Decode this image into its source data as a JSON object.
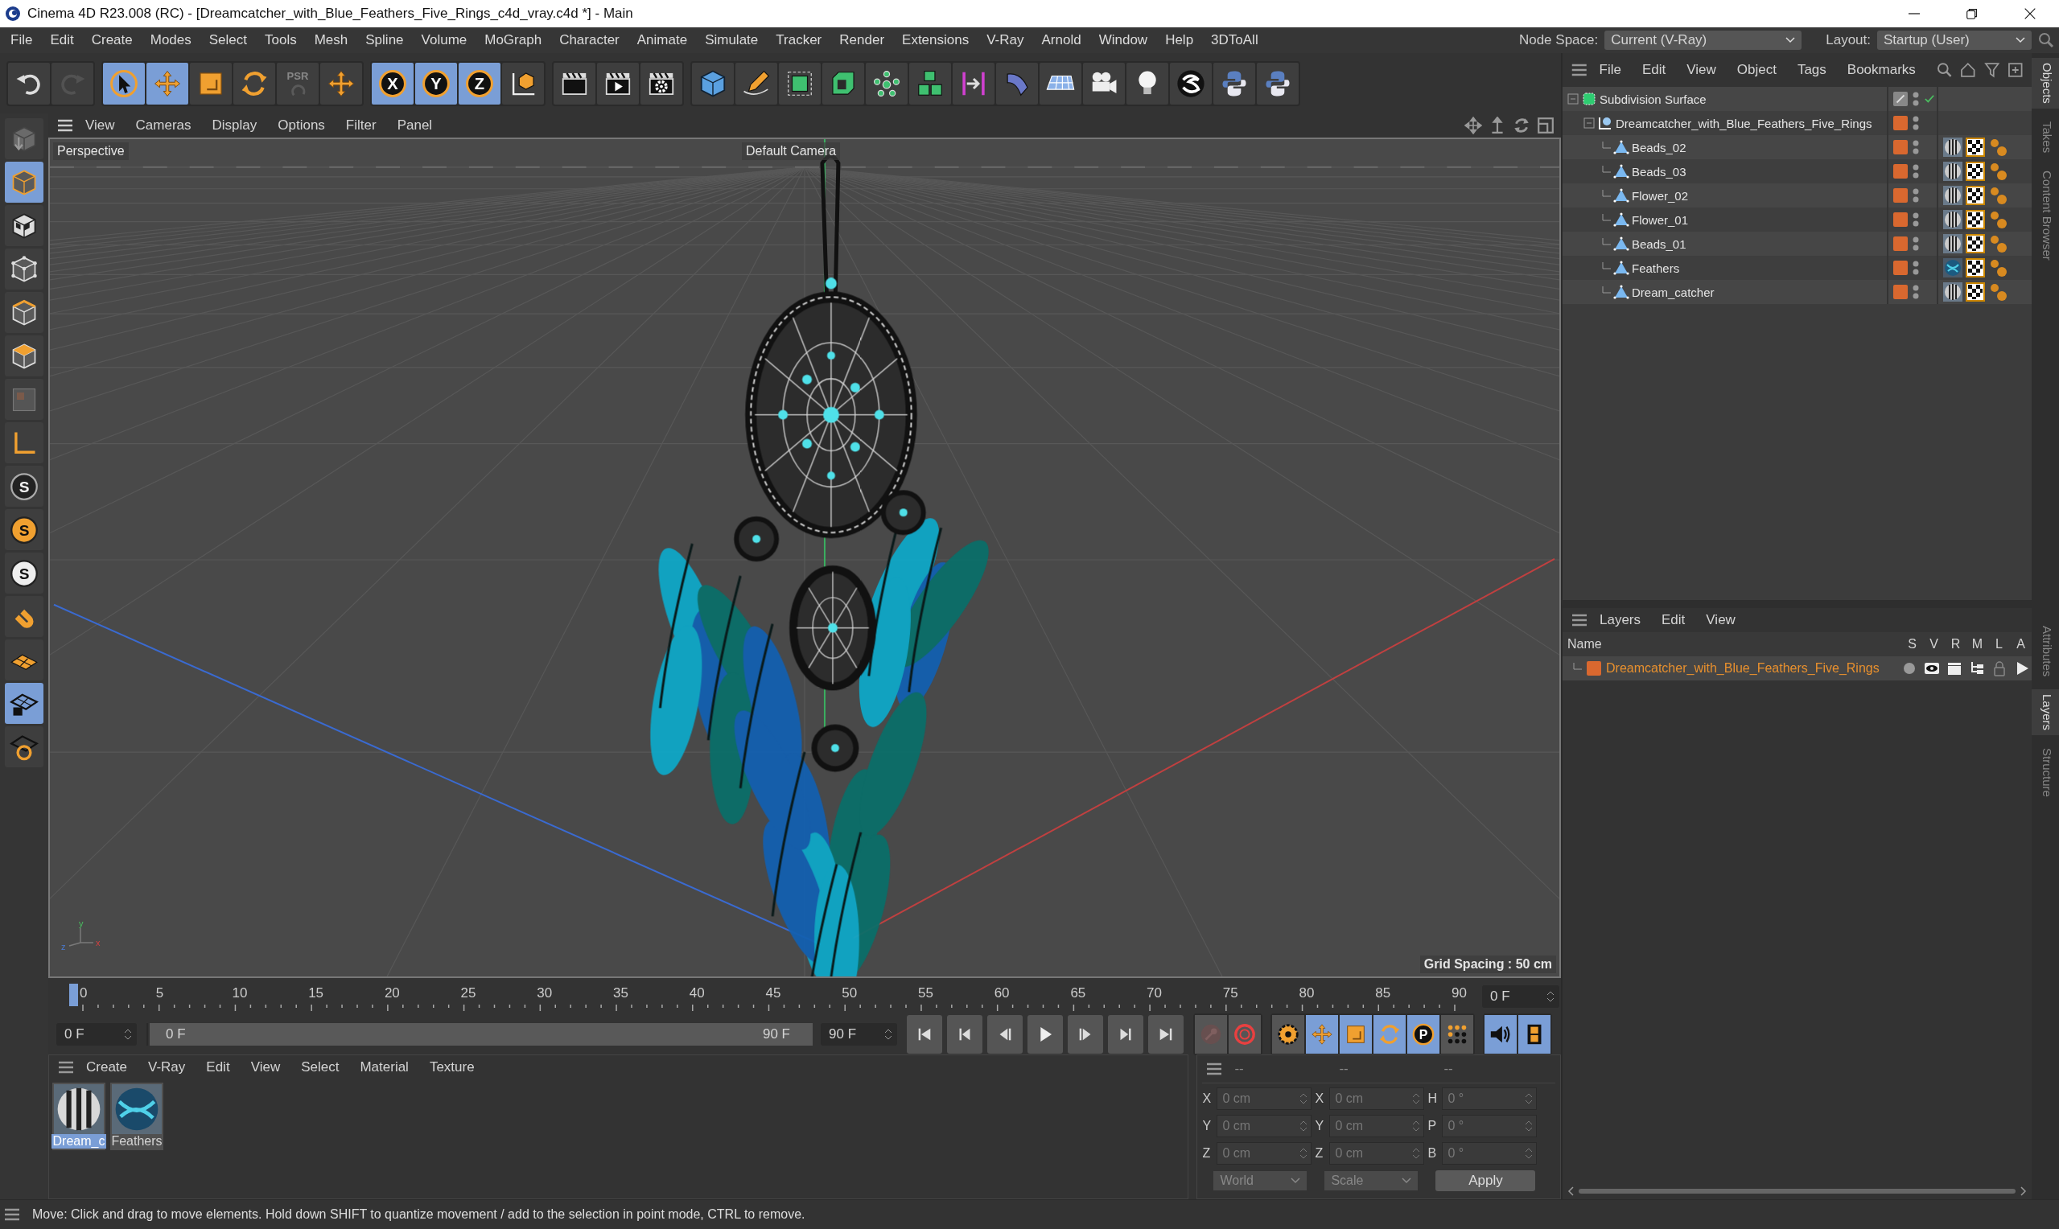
{
  "window": {
    "title": "Cinema 4D R23.008 (RC) - [Dreamcatcher_with_Blue_Feathers_Five_Rings_c4d_vray.c4d *] - Main"
  },
  "menu": [
    "File",
    "Edit",
    "Create",
    "Modes",
    "Select",
    "Tools",
    "Mesh",
    "Spline",
    "Volume",
    "MoGraph",
    "Character",
    "Animate",
    "Simulate",
    "Tracker",
    "Render",
    "Extensions",
    "V-Ray",
    "Arnold",
    "Window",
    "Help",
    "3DToAll"
  ],
  "node_space": {
    "label": "Node Space:",
    "value": "Current (V-Ray)"
  },
  "layout": {
    "label": "Layout:",
    "value": "Startup (User)"
  },
  "toolbar": [
    [
      {
        "kind": "undo",
        "selected": false,
        "disabled": false
      },
      {
        "kind": "redo",
        "selected": false,
        "disabled": true
      }
    ],
    [
      {
        "kind": "select",
        "selected": true,
        "disabled": false
      },
      {
        "kind": "move",
        "selected": true,
        "disabled": false
      },
      {
        "kind": "scale",
        "selected": false,
        "disabled": false
      },
      {
        "kind": "rotate",
        "selected": false,
        "disabled": false
      },
      {
        "kind": "psr",
        "label": "PSR",
        "selected": false,
        "disabled": true
      },
      {
        "kind": "add",
        "selected": false,
        "disabled": false
      }
    ],
    [
      {
        "kind": "axis",
        "label": "X",
        "selected": true,
        "disabled": false
      },
      {
        "kind": "axis",
        "label": "Y",
        "selected": true,
        "disabled": false
      },
      {
        "kind": "axis",
        "label": "Z",
        "selected": true,
        "disabled": false
      },
      {
        "kind": "coord",
        "selected": false,
        "disabled": false
      }
    ],
    [
      {
        "kind": "clapper",
        "selected": false,
        "disabled": false
      },
      {
        "kind": "render",
        "selected": false,
        "disabled": false
      },
      {
        "kind": "render-settings",
        "selected": false,
        "disabled": false
      }
    ],
    [
      {
        "kind": "cube",
        "selected": false,
        "disabled": false
      },
      {
        "kind": "pen",
        "selected": false,
        "disabled": false
      },
      {
        "kind": "subdiv",
        "selected": false,
        "disabled": false
      },
      {
        "kind": "extrude",
        "selected": false,
        "disabled": false
      },
      {
        "kind": "cloner",
        "selected": false,
        "disabled": false
      },
      {
        "kind": "array",
        "selected": false,
        "disabled": false
      },
      {
        "kind": "deformer",
        "selected": false,
        "disabled": false
      },
      {
        "kind": "bend",
        "selected": false,
        "disabled": false
      },
      {
        "kind": "floor",
        "selected": false,
        "disabled": false
      },
      {
        "kind": "camera",
        "selected": false,
        "disabled": false
      },
      {
        "kind": "light",
        "selected": false,
        "disabled": false
      },
      {
        "kind": "vray",
        "selected": false,
        "disabled": false
      },
      {
        "kind": "python",
        "selected": false,
        "disabled": false
      },
      {
        "kind": "python",
        "selected": false,
        "disabled": false
      }
    ]
  ],
  "left_tools": [
    {
      "kind": "editable",
      "selected": false
    },
    {
      "kind": "model",
      "selected": true
    },
    {
      "kind": "texture",
      "selected": false
    },
    {
      "kind": "points",
      "selected": false
    },
    {
      "kind": "edges",
      "selected": false
    },
    {
      "kind": "polygons",
      "selected": false
    },
    {
      "kind": "uv",
      "selected": false
    },
    {
      "kind": "axis-mode",
      "selected": false
    },
    {
      "kind": "snap-dark",
      "label": "S",
      "selected": false
    },
    {
      "kind": "snap",
      "label": "S",
      "selected": false
    },
    {
      "kind": "snap-light",
      "label": "S",
      "selected": false
    },
    {
      "kind": "magnet",
      "selected": false
    },
    {
      "kind": "workplane",
      "selected": false
    },
    {
      "kind": "workplane-lock",
      "selected": true
    },
    {
      "kind": "planar",
      "selected": false
    }
  ],
  "viewport": {
    "menu": [
      "View",
      "Cameras",
      "Display",
      "Options",
      "Filter",
      "Panel"
    ],
    "view_name": "Perspective",
    "camera": "Default Camera",
    "grid_spacing": "Grid Spacing : 50 cm",
    "gizmo": {
      "x": "x",
      "y": "y",
      "z": "z"
    }
  },
  "timeline": {
    "ticks": [
      "0",
      "5",
      "10",
      "15",
      "20",
      "25",
      "30",
      "35",
      "40",
      "45",
      "50",
      "55",
      "60",
      "65",
      "70",
      "75",
      "80",
      "85",
      "90"
    ],
    "frame": "0 F",
    "start": "0 F",
    "range_start": "0 F",
    "range_end": "90 F",
    "range": {
      "level": 1
    },
    "end": "90 F"
  },
  "playback": [
    {
      "kind": "first"
    },
    {
      "kind": "prev-key"
    },
    {
      "kind": "prev-frame"
    },
    {
      "kind": "play"
    },
    {
      "kind": "next-frame"
    },
    {
      "kind": "next-key"
    },
    {
      "kind": "last"
    }
  ],
  "anim_tools": [
    [
      {
        "kind": "record",
        "selected": false,
        "disabled": true
      },
      {
        "kind": "autokey",
        "selected": false,
        "disabled": false
      }
    ],
    [
      {
        "kind": "key-settings",
        "selected": false,
        "disabled": false
      },
      {
        "kind": "move",
        "selected": true,
        "disabled": false
      },
      {
        "kind": "scale",
        "selected": true,
        "disabled": false
      },
      {
        "kind": "rotate",
        "selected": true,
        "disabled": false
      },
      {
        "kind": "param",
        "label": "P",
        "selected": true,
        "disabled": false
      },
      {
        "kind": "dots",
        "selected": false,
        "disabled": false
      }
    ],
    [
      {
        "kind": "sound",
        "selected": true,
        "disabled": false
      },
      {
        "kind": "film",
        "selected": true,
        "disabled": false
      }
    ]
  ],
  "materials": {
    "menu": [
      "Create",
      "V-Ray",
      "Edit",
      "View",
      "Select",
      "Material",
      "Texture"
    ],
    "items": [
      {
        "name": "Dream_c",
        "kind": "striped",
        "selected": true
      },
      {
        "name": "Feathers",
        "kind": "feather",
        "selected": false
      }
    ]
  },
  "coordinates": {
    "headers": [
      "--",
      "--",
      "--"
    ],
    "rows": [
      [
        {
          "axis": "X",
          "value": "0 cm"
        },
        {
          "axis": "X",
          "value": "0 cm"
        },
        {
          "axis": "H",
          "value": "0 °"
        }
      ],
      [
        {
          "axis": "Y",
          "value": "0 cm"
        },
        {
          "axis": "Y",
          "value": "0 cm"
        },
        {
          "axis": "P",
          "value": "0 °"
        }
      ],
      [
        {
          "axis": "Z",
          "value": "0 cm"
        },
        {
          "axis": "Z",
          "value": "0 cm"
        },
        {
          "axis": "B",
          "value": "0 °"
        }
      ]
    ],
    "space": "World",
    "mode": "Scale",
    "apply": "Apply"
  },
  "objects": {
    "menu": [
      "File",
      "Edit",
      "View",
      "Object",
      "Tags",
      "Bookmarks"
    ],
    "items": [
      {
        "name": "Subdivision Surface",
        "kind": "subdivision",
        "layer": false,
        "enabled": true,
        "children": [
          {
            "name": "Dreamcatcher_with_Blue_Feathers_Five_Rings",
            "kind": "null",
            "layer": true,
            "children": [
              {
                "name": "Beads_02",
                "kind": "polygon",
                "layer": true,
                "tags": [
                  {
                    "kind": "material"
                  },
                  {
                    "kind": "uvw"
                  },
                  {
                    "kind": "phong"
                  }
                ]
              },
              {
                "name": "Beads_03",
                "kind": "polygon",
                "layer": true,
                "tags": [
                  {
                    "kind": "material"
                  },
                  {
                    "kind": "uvw"
                  },
                  {
                    "kind": "phong"
                  }
                ]
              },
              {
                "name": "Flower_02",
                "kind": "polygon",
                "layer": true,
                "tags": [
                  {
                    "kind": "material"
                  },
                  {
                    "kind": "uvw"
                  },
                  {
                    "kind": "phong"
                  }
                ]
              },
              {
                "name": "Flower_01",
                "kind": "polygon",
                "layer": true,
                "tags": [
                  {
                    "kind": "material"
                  },
                  {
                    "kind": "uvw"
                  },
                  {
                    "kind": "phong"
                  }
                ]
              },
              {
                "name": "Beads_01",
                "kind": "polygon",
                "layer": true,
                "tags": [
                  {
                    "kind": "material"
                  },
                  {
                    "kind": "uvw"
                  },
                  {
                    "kind": "phong"
                  }
                ]
              },
              {
                "name": "Feathers",
                "kind": "polygon",
                "layer": true,
                "tags": [
                  {
                    "kind": "feather-material"
                  },
                  {
                    "kind": "uvw"
                  },
                  {
                    "kind": "phong"
                  }
                ]
              },
              {
                "name": "Dream_catcher",
                "kind": "polygon",
                "layer": true,
                "tags": [
                  {
                    "kind": "material"
                  },
                  {
                    "kind": "uvw"
                  },
                  {
                    "kind": "phong"
                  }
                ]
              }
            ]
          }
        ]
      }
    ]
  },
  "layers": {
    "menu": [
      "Layers",
      "Edit",
      "View"
    ],
    "columns": [
      "Name",
      "S",
      "V",
      "R",
      "M",
      "L",
      "A"
    ],
    "rows": [
      {
        "name": "Dreamcatcher_with_Blue_Feathers_Five_Rings"
      }
    ]
  },
  "side_tabs": {
    "top": [
      {
        "label": "Objects",
        "selected": true
      },
      {
        "label": "Takes",
        "selected": false
      },
      {
        "label": "Content Browser",
        "selected": false
      }
    ],
    "bottom": [
      {
        "label": "Attributes",
        "selected": false
      },
      {
        "label": "Layers",
        "selected": true
      },
      {
        "label": "Structure",
        "selected": false
      }
    ]
  },
  "status": "Move: Click and drag to move elements. Hold down SHIFT to quantize movement / add to the selection in point mode, CTRL to remove."
}
